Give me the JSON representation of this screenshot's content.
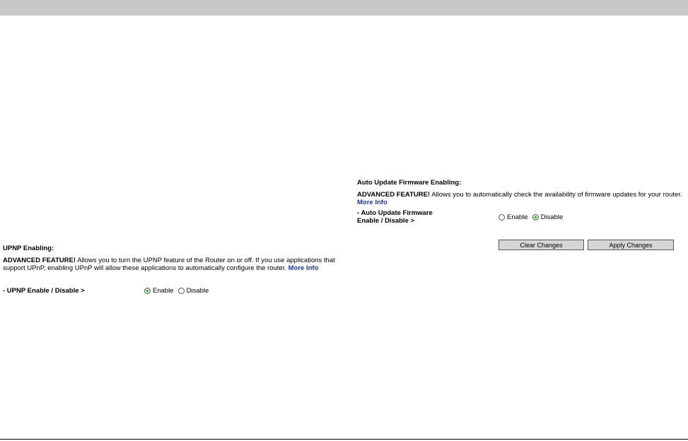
{
  "auto_update": {
    "heading": "Auto Update Firmware Enabling:",
    "advanced_label": "ADVANCED FEATURE!",
    "description": " Allows you to automatically check the availability of firmware updates for your router.",
    "more_info": "More Info",
    "field_label_line1": "- Auto Update Firmware",
    "field_label_line2": "Enable / Disable >",
    "option_enable": "Enable",
    "option_disable": "Disable",
    "selected": "Disable"
  },
  "buttons": {
    "clear": "Clear Changes",
    "apply": "Apply Changes"
  },
  "upnp": {
    "heading": "UPNP Enabling:",
    "advanced_label": "ADVANCED FEATURE!",
    "description": " Allows you to turn the UPNP feature of the Router on or off. If you use applications that support UPnP, enabling UPnP will allow these applications to automatically configure the router.",
    "more_info": "More Info",
    "field_label": "- UPNP Enable / Disable >",
    "option_enable": "Enable",
    "option_disable": "Disable",
    "selected": "Enable"
  }
}
